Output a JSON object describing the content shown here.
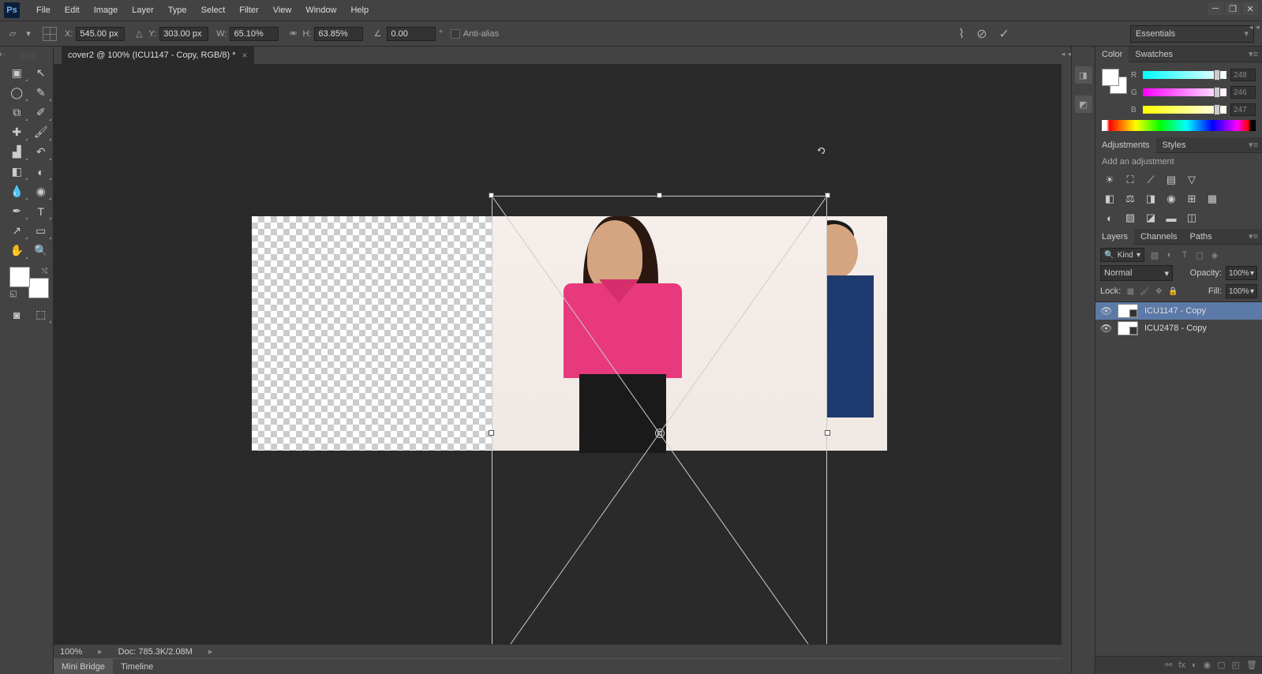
{
  "menu": {
    "file": "File",
    "edit": "Edit",
    "image": "Image",
    "layer": "Layer",
    "type": "Type",
    "select": "Select",
    "filter": "Filter",
    "view": "View",
    "window": "Window",
    "help": "Help"
  },
  "options": {
    "x_label": "X:",
    "x_val": "545.00 px",
    "y_label": "Y:",
    "y_val": "303.00 px",
    "w_label": "W:",
    "w_val": "65.10%",
    "h_label": "H:",
    "h_val": "63.85%",
    "rot_val": "0.00",
    "antialias": "Anti-alias"
  },
  "workspace": "Essentials",
  "document": {
    "tab_title": "cover2 @ 100% (ICU1147 - Copy, RGB/8) *"
  },
  "status": {
    "zoom": "100%",
    "doc_size": "Doc: 785.3K/2.08M"
  },
  "bottom_tabs": {
    "mini_bridge": "Mini Bridge",
    "timeline": "Timeline"
  },
  "panels": {
    "color": "Color",
    "swatches": "Swatches",
    "adjustments": "Adjustments",
    "styles": "Styles",
    "layers": "Layers",
    "channels": "Channels",
    "paths": "Paths"
  },
  "color_panel": {
    "r": "R",
    "g": "G",
    "b": "B",
    "r_val": "248",
    "g_val": "246",
    "b_val": "247"
  },
  "adjustments_panel": {
    "add_title": "Add an adjustment"
  },
  "layers_panel": {
    "kind": "Kind",
    "normal": "Normal",
    "opacity_label": "Opacity:",
    "opacity_val": "100%",
    "lock_label": "Lock:",
    "fill_label": "Fill:",
    "fill_val": "100%",
    "items": [
      {
        "name": "ICU1147 - Copy"
      },
      {
        "name": "ICU2478 - Copy"
      }
    ]
  }
}
